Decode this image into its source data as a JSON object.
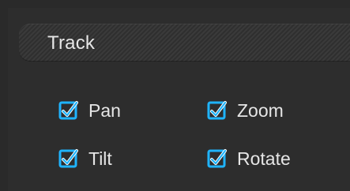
{
  "panel": {
    "title": "Track",
    "options": [
      {
        "id": "pan",
        "label": "Pan",
        "checked": true
      },
      {
        "id": "zoom",
        "label": "Zoom",
        "checked": true
      },
      {
        "id": "tilt",
        "label": "Tilt",
        "checked": true
      },
      {
        "id": "rotate",
        "label": "Rotate",
        "checked": true
      }
    ]
  },
  "colors": {
    "background": "#2a2a2a",
    "text": "#e6e6e6",
    "checkbox_accent": "#1fb4ff",
    "checkmark": "#ffffff"
  },
  "icons": {
    "checkbox_checked": "checkbox-checked-icon"
  }
}
